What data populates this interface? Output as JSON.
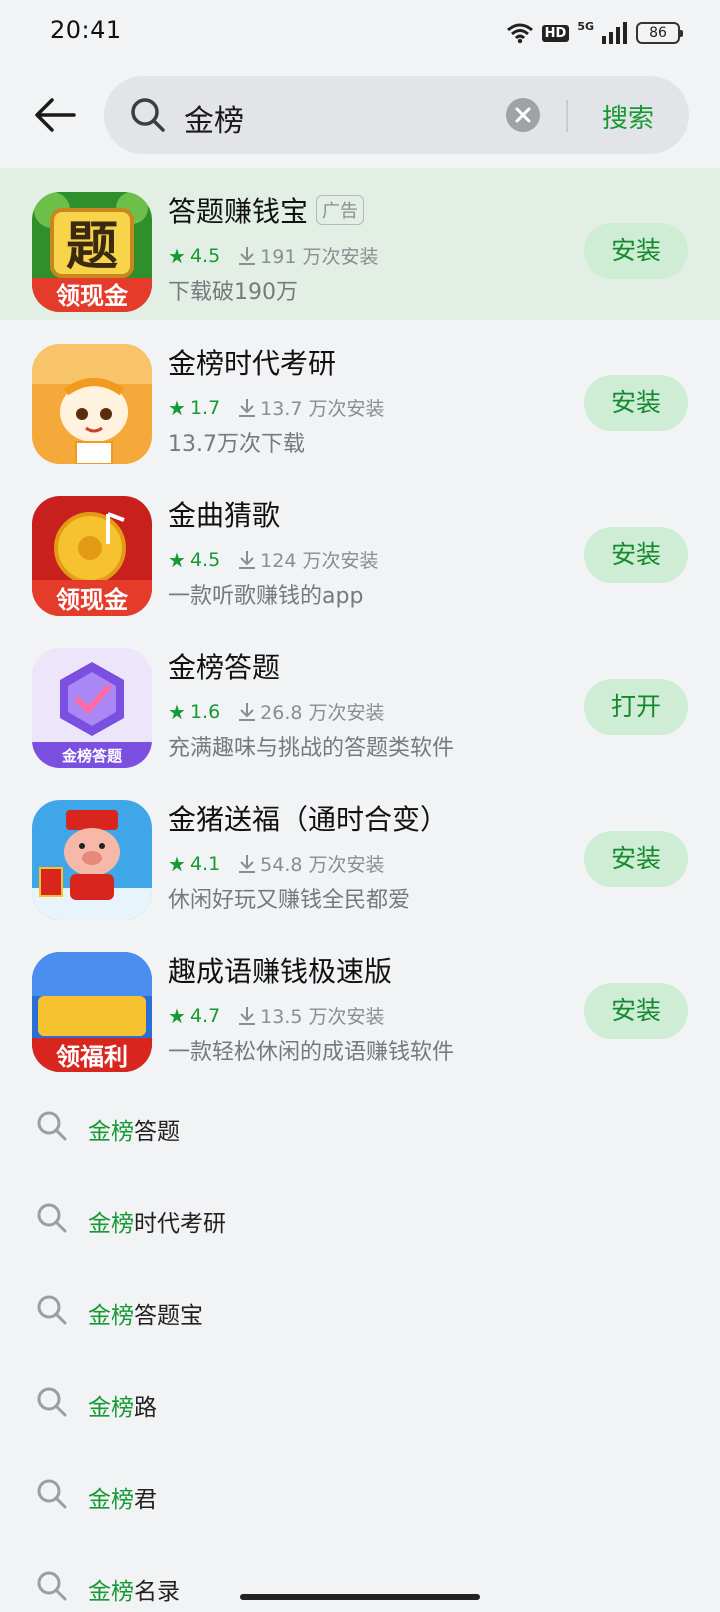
{
  "status_bar": {
    "time": "20:41",
    "hd_label": "HD",
    "network_label": "5G",
    "battery": "86",
    "icons": [
      "wifi-icon",
      "hd-badge",
      "signal-icon",
      "battery-icon"
    ]
  },
  "search": {
    "query": "金榜",
    "submit_label": "搜索"
  },
  "colors": {
    "accent": "#159a33",
    "ad_background": "#e3efe4",
    "button_background": "#cfecd4"
  },
  "apps": [
    {
      "name": "答题赚钱宝",
      "ad_label": "广告",
      "rating": "4.5",
      "installs": "191 万次安装",
      "desc": "下载破190万",
      "action": "安装",
      "icon": "app-icon-datizhuanqianbao",
      "icon_caption": "领现金"
    },
    {
      "name": "金榜时代考研",
      "rating": "1.7",
      "installs": "13.7 万次安装",
      "desc": "13.7万次下载",
      "action": "安装",
      "icon": "app-icon-jinbangshidai"
    },
    {
      "name": "金曲猜歌",
      "rating": "4.5",
      "installs": "124 万次安装",
      "desc": "一款听歌赚钱的app",
      "action": "安装",
      "icon": "app-icon-jinqucaige",
      "icon_caption": "领现金"
    },
    {
      "name": "金榜答题",
      "rating": "1.6",
      "installs": "26.8 万次安装",
      "desc": "充满趣味与挑战的答题类软件",
      "action": "打开",
      "icon": "app-icon-jinbangdati",
      "icon_caption": "金榜答题"
    },
    {
      "name": "金猪送福（通时合变）",
      "rating": "4.1",
      "installs": "54.8 万次安装",
      "desc": "休闲好玩又赚钱全民都爱",
      "action": "安装",
      "icon": "app-icon-jinzhusongfu"
    },
    {
      "name": "趣成语赚钱极速版",
      "rating": "4.7",
      "installs": "13.5 万次安装",
      "desc": "一款轻松休闲的成语赚钱软件",
      "action": "安装",
      "icon": "app-icon-quchengyu",
      "icon_caption": "领福利"
    }
  ],
  "suggestions": [
    {
      "highlight": "金榜",
      "rest": "答题"
    },
    {
      "highlight": "金榜",
      "rest": "时代考研"
    },
    {
      "highlight": "金榜",
      "rest": "答题宝"
    },
    {
      "highlight": "金榜",
      "rest": "路"
    },
    {
      "highlight": "金榜",
      "rest": "君"
    },
    {
      "highlight": "金榜",
      "rest": "名录"
    }
  ]
}
